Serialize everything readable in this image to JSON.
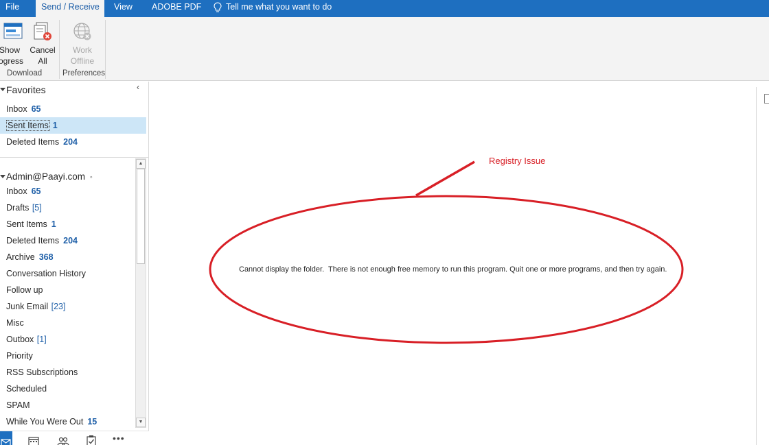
{
  "ribbon_tabs": {
    "file": "File",
    "send_receive": "Send / Receive",
    "view": "View",
    "adobe_pdf": "ADOBE PDF",
    "tell_me": "Tell me what you want to do"
  },
  "ribbon": {
    "show_progress": "Show\nrogress",
    "cancel_all": "Cancel\nAll",
    "work_offline": "Work\nOffline",
    "group_download": "Download",
    "group_preferences": "Preferences"
  },
  "favorites": {
    "header": "Favorites",
    "items": [
      {
        "name": "Inbox",
        "count": "65"
      },
      {
        "name": "Sent Items",
        "count": "1"
      },
      {
        "name": "Deleted Items",
        "count": "204"
      }
    ]
  },
  "account": {
    "header": "Admin@Paayi.com",
    "items": [
      {
        "name": "Inbox",
        "count": "65",
        "count_style": "bold"
      },
      {
        "name": "Drafts",
        "count": "[5]",
        "count_style": "bracket"
      },
      {
        "name": "Sent Items",
        "count": "1",
        "count_style": "bold"
      },
      {
        "name": "Deleted Items",
        "count": "204",
        "count_style": "bold"
      },
      {
        "name": "Archive",
        "count": "368",
        "count_style": "bold"
      },
      {
        "name": "Conversation History",
        "count": "",
        "count_style": ""
      },
      {
        "name": "Follow up",
        "count": "",
        "count_style": ""
      },
      {
        "name": "Junk Email",
        "count": "[23]",
        "count_style": "bracket"
      },
      {
        "name": "Misc",
        "count": "",
        "count_style": ""
      },
      {
        "name": "Outbox",
        "count": "[1]",
        "count_style": "bracket"
      },
      {
        "name": "Priority",
        "count": "",
        "count_style": ""
      },
      {
        "name": "RSS Subscriptions",
        "count": "",
        "count_style": ""
      },
      {
        "name": "Scheduled",
        "count": "",
        "count_style": ""
      },
      {
        "name": "SPAM",
        "count": "",
        "count_style": ""
      },
      {
        "name": "While You Were Out",
        "count": "15",
        "count_style": "bold"
      }
    ]
  },
  "bottom_nav_icons": [
    "mail-icon",
    "calendar-icon",
    "people-icon",
    "tasks-icon",
    "more-icon"
  ],
  "reading_pane": {
    "message": "Cannot display the folder.  There is not enough free memory to run this program. Quit one or more programs, and then try again."
  },
  "annotation": {
    "label": "Registry Issue",
    "color": "#d81f26"
  },
  "colors": {
    "accent": "#1e6fc0",
    "selected_bg": "#cde6f7",
    "count_blue": "#1e5fa8"
  }
}
